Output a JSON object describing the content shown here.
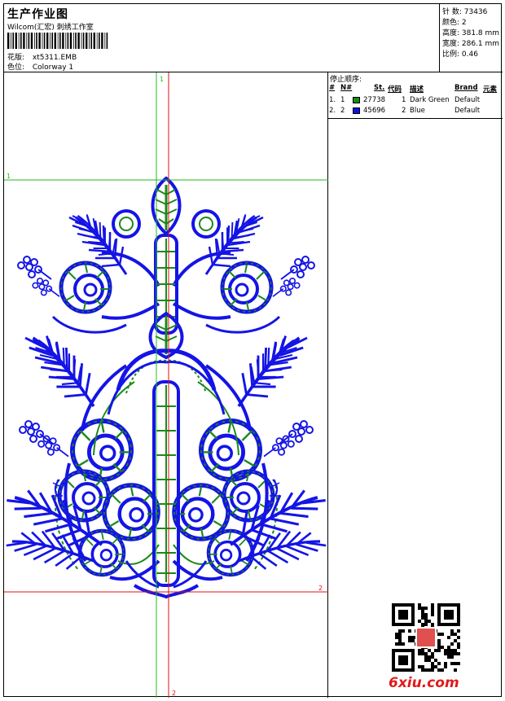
{
  "header": {
    "title": "生产作业图",
    "subtitle": "Wilcom(汇宏) 刺绣工作室",
    "design_label": "花版:",
    "design_value": "xt5311.EMB",
    "colorway_label": "色位:",
    "colorway_value": "Colorway 1"
  },
  "stats": {
    "stitches": "针 数: 73436",
    "colors": "颜色: 2",
    "height": "高度: 381.8 mm",
    "width": "宽度: 286.1 mm",
    "scale": "比例: 0.46"
  },
  "stop_sequence": {
    "title": "停止顺序:",
    "headers": [
      "#",
      "N#",
      "St.",
      "代码",
      "描述",
      "Brand",
      "元素"
    ],
    "rows": [
      {
        "idx": "1.",
        "needle": "1",
        "stitches": "27738",
        "code": "1",
        "desc": "Dark Green",
        "brand": "Default",
        "color": "#1a8a1a"
      },
      {
        "idx": "2.",
        "needle": "2",
        "stitches": "45696",
        "code": "2",
        "desc": "Blue",
        "brand": "Default",
        "color": "#1010e6"
      }
    ]
  },
  "markers": {
    "top": "1",
    "left": "1",
    "right": "2",
    "bottom": "2"
  },
  "watermark": "6xiu.com",
  "colors": {
    "blue": "#1414e6",
    "green": "#1a8a1a",
    "guide_red": "#e01010",
    "guide_green": "#22bb22"
  }
}
